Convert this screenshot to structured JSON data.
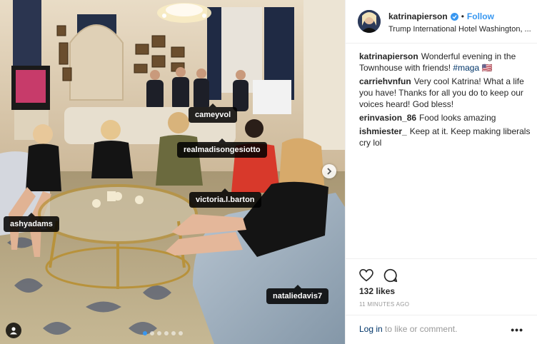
{
  "post": {
    "username": "katrinapierson",
    "verified": true,
    "follow_label": "Follow",
    "separator": "•",
    "location": "Trump International Hotel Washington, ..."
  },
  "photo": {
    "tags": [
      {
        "label": "cameyvol"
      },
      {
        "label": "realmadisongesiotto"
      },
      {
        "label": "victoria.l.barton"
      },
      {
        "label": "ashyadams"
      },
      {
        "label": "nataliedavis7"
      }
    ],
    "next_icon": "chevron-right-icon",
    "user_tag_icon": "person-icon",
    "carousel_count": 6,
    "carousel_active": 1
  },
  "comments": [
    {
      "user": "katrinapierson",
      "text": "Wonderful evening in the Townhouse with friends!",
      "hashtag": "#maga",
      "flag": "🇺🇸"
    },
    {
      "user": "carriehvnfun",
      "text": "Very cool Katrina! What a life you have! Thanks for all you do to keep our voices heard! God bless!"
    },
    {
      "user": "erinvasion_86",
      "text": "Food looks amazing"
    },
    {
      "user": "ishmiester_",
      "text": "Keep at it. Keep making liberals cry lol"
    }
  ],
  "actions": {
    "like_icon": "heart-icon",
    "comment_icon": "comment-bubble-icon",
    "likes": "132 likes",
    "time": "11 MINUTES AGO"
  },
  "add_comment": {
    "login_link": "Log in",
    "login_text": "to like or comment.",
    "more_label": "•••"
  },
  "colors": {
    "link_blue": "#3897f0",
    "hashtag": "#003569",
    "tag_bg": "#000000"
  }
}
